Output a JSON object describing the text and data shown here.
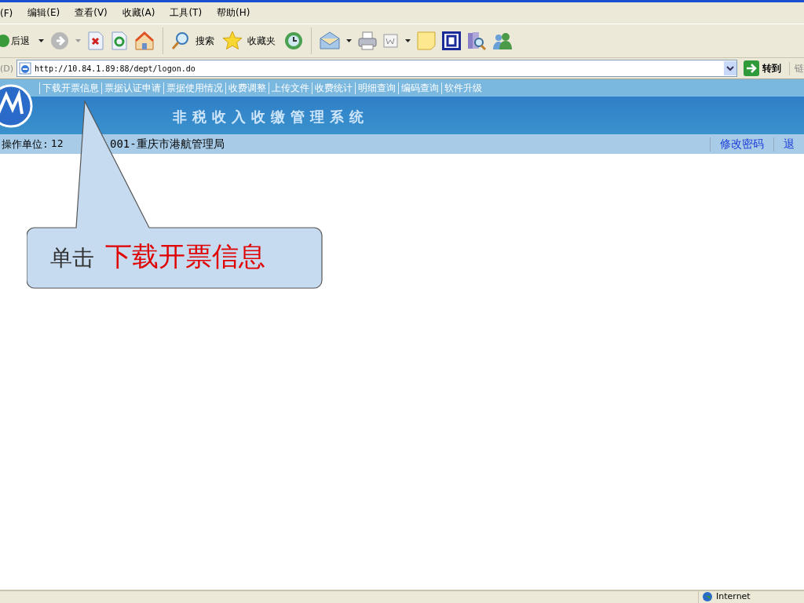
{
  "menu_bar": [
    "(F)",
    "编辑(E)",
    "查看(V)",
    "收藏(A)",
    "工具(T)",
    "帮助(H)"
  ],
  "toolbar": {
    "back": "后退",
    "search": "搜索",
    "favorites": "收藏夹"
  },
  "address_bar": {
    "label": "(D)",
    "url": "http://10.84.1.89:88/dept/logon.do",
    "go": "转到",
    "links": "链"
  },
  "app": {
    "nav": [
      "下载开票信息",
      "票据认证申请",
      "票据使用情况",
      "收费调整",
      "上传文件",
      "收费统计",
      "明细查询",
      "编码查询",
      "软件升级"
    ],
    "title": "非税收入收缴管理系统",
    "unit_label": "操作单位:",
    "unit_code": "12",
    "unit_rest": "001-重庆市港航管理局",
    "links": [
      "修改密码",
      "退"
    ]
  },
  "callout": {
    "prefix": "单击",
    "target": "下载开票信息"
  },
  "status_bar": {
    "zone": "Internet"
  }
}
